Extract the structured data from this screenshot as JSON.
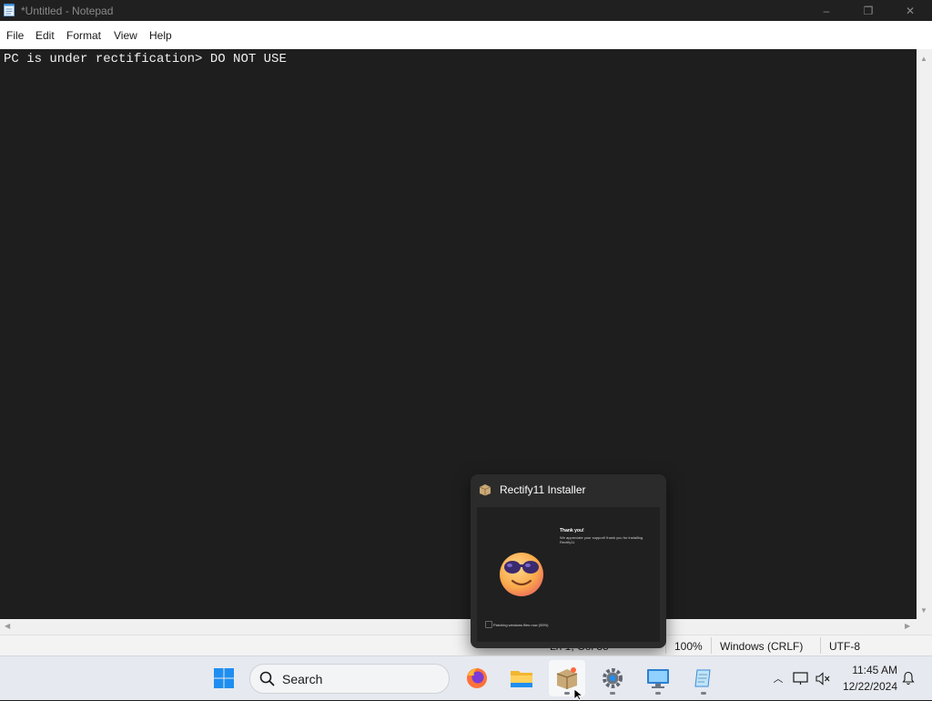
{
  "window": {
    "title": "*Untitled - Notepad",
    "controls": {
      "minimize": "–",
      "restore": "❐",
      "close": "✕"
    }
  },
  "menu": {
    "items": [
      "File",
      "Edit",
      "Format",
      "View",
      "Help"
    ]
  },
  "editor": {
    "content": "PC is under rectification> DO NOT USE"
  },
  "statusbar": {
    "position": "Ln 1, Col 38",
    "zoom": "100%",
    "line_ending": "Windows (CRLF)",
    "encoding": "UTF-8"
  },
  "taskbar": {
    "search_placeholder": "Search",
    "apps": [
      {
        "name": "start",
        "icon": "windows-start-icon"
      },
      {
        "name": "firefox",
        "icon": "firefox-icon"
      },
      {
        "name": "file-explorer",
        "icon": "folder-icon"
      },
      {
        "name": "rectify11-installer",
        "icon": "package-box-icon",
        "active": true
      },
      {
        "name": "settings",
        "icon": "gear-icon"
      },
      {
        "name": "control-panel",
        "icon": "monitor-icon"
      },
      {
        "name": "notepad",
        "icon": "notepad-icon"
      }
    ],
    "tray": {
      "time": "11:45 AM",
      "date": "12/22/2024"
    }
  },
  "preview": {
    "title": "Rectify11 Installer",
    "heading": "Thank you!",
    "message": "We appreciate your support! thank you for installing Rectify11",
    "status": "Patching windows files now (55%)"
  },
  "colors": {
    "accent": "#0067c0",
    "editor_bg": "#1e1e1e",
    "titlebar_bg": "#202020",
    "taskbar_bg": "#e6e9ef"
  }
}
